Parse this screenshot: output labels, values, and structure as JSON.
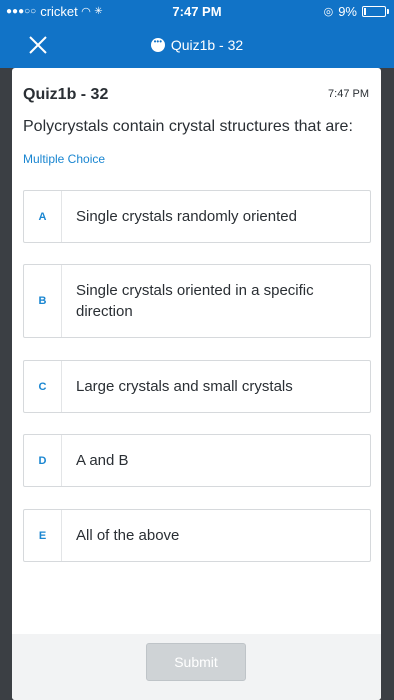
{
  "status_bar": {
    "carrier": "cricket",
    "time": "7:47 PM",
    "battery": "9%"
  },
  "header": {
    "title": "Quiz1b - 32",
    "close_icon": "close-icon",
    "chat_icon": "chat-bubble-icon"
  },
  "quiz": {
    "title": "Quiz1b - 32",
    "time": "7:47 PM",
    "question": "Polycrystals contain crystal structures that are:",
    "type": "Multiple Choice",
    "options": [
      {
        "letter": "A",
        "text": "Single crystals randomly oriented"
      },
      {
        "letter": "B",
        "text": "Single crystals oriented in a specific direction"
      },
      {
        "letter": "C",
        "text": "Large crystals and small crystals"
      },
      {
        "letter": "D",
        "text": "A and B"
      },
      {
        "letter": "E",
        "text": "All of the above"
      }
    ],
    "submit_label": "Submit"
  },
  "colors": {
    "header_bg": "#1173c7",
    "accent": "#1a86d1",
    "page_bg": "#3b3f44"
  }
}
